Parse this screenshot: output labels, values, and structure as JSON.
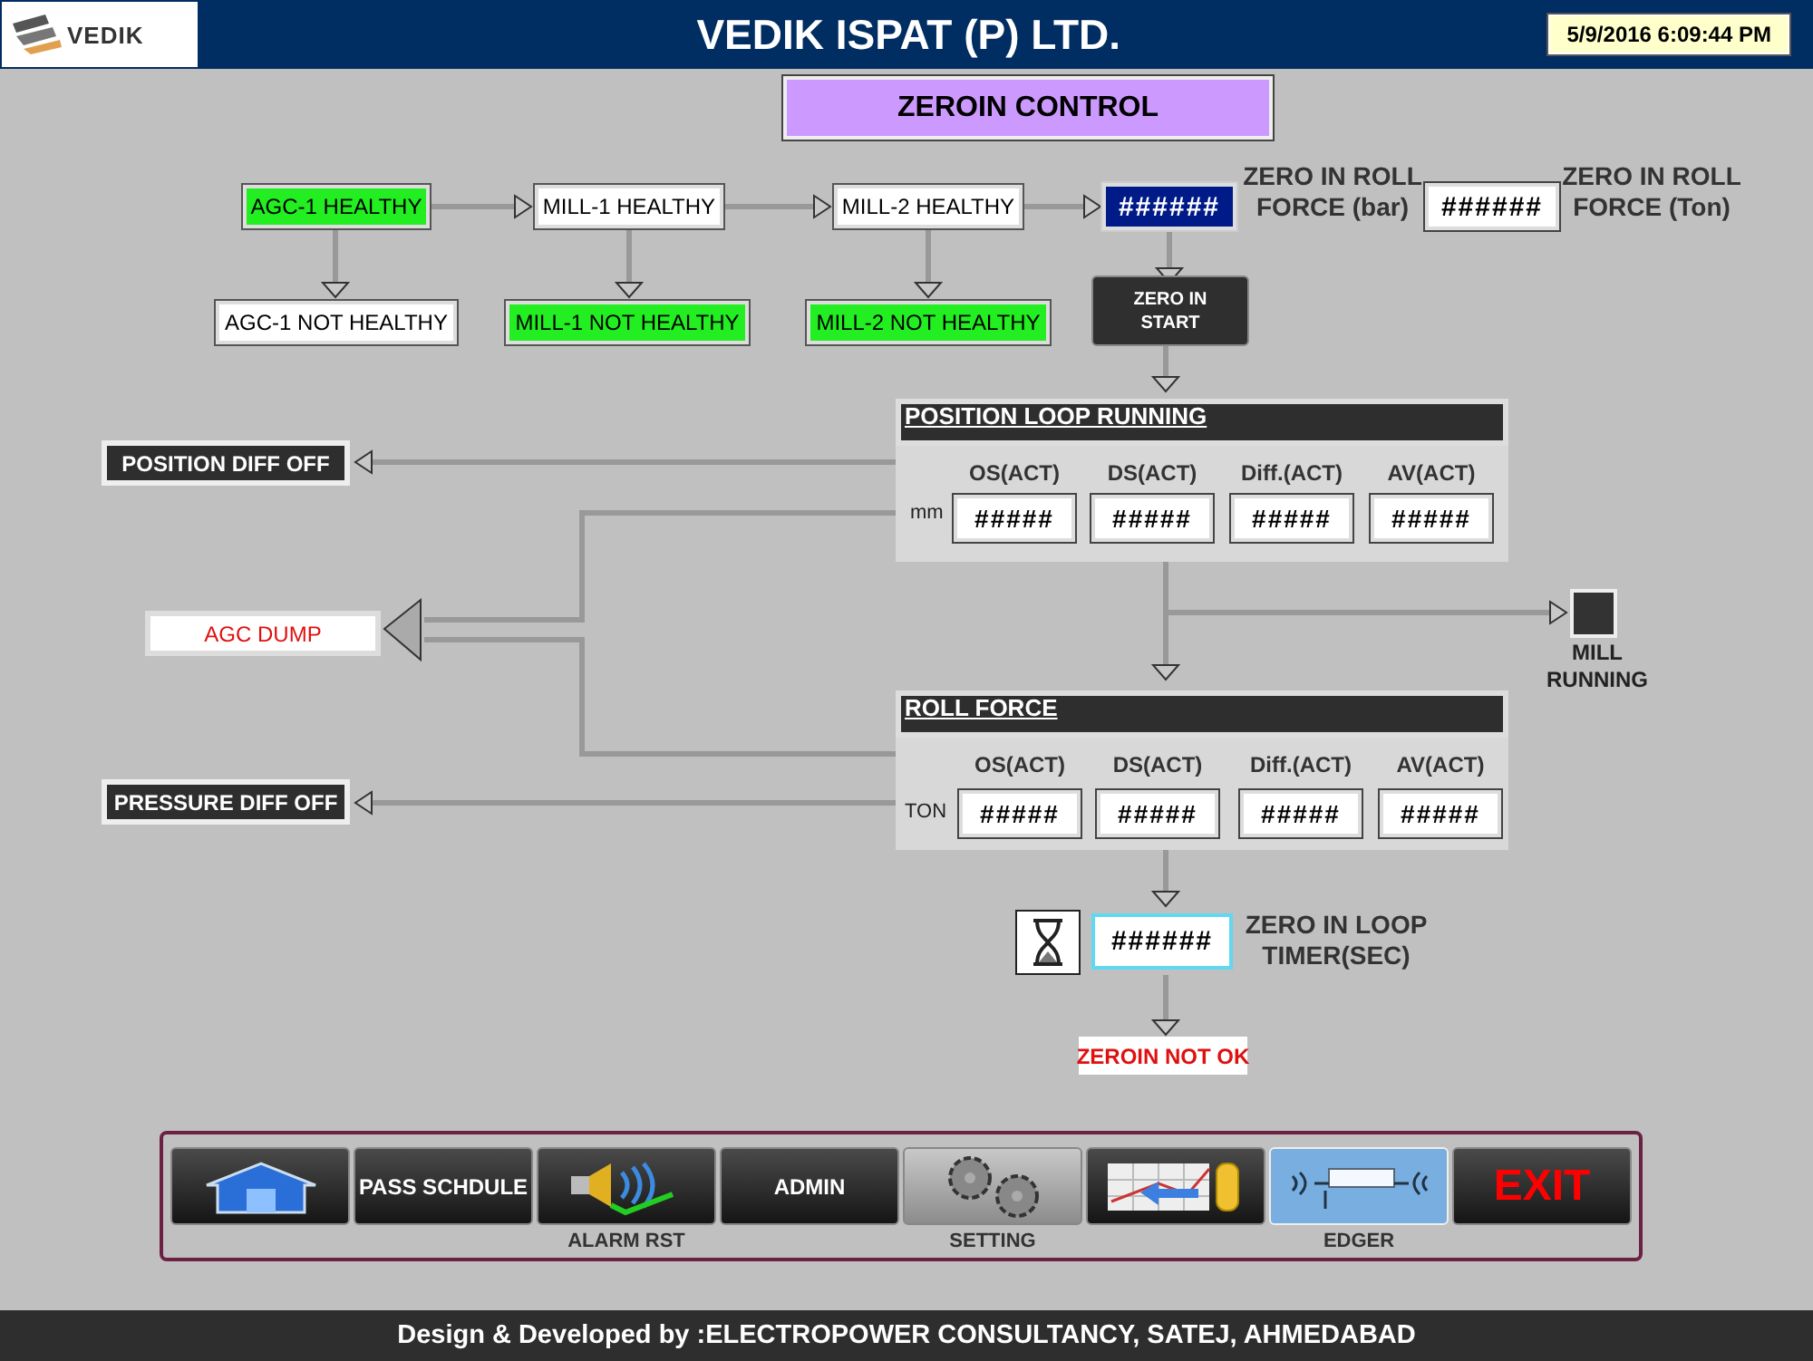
{
  "header": {
    "logo_text": "VEDIK",
    "title": "VEDIK ISPAT (P) LTD.",
    "datetime": "5/9/2016 6:09:44 PM"
  },
  "page_title": "ZEROIN CONTROL",
  "health": [
    {
      "label": "AGC-1 HEALTHY",
      "on": true
    },
    {
      "label": "MILL-1 HEALTHY",
      "on": false
    },
    {
      "label": "MILL-2 HEALTHY",
      "on": false
    }
  ],
  "faults": [
    {
      "label": "AGC-1 NOT HEALTHY",
      "on": false
    },
    {
      "label": "MILL-1 NOT HEALTHY",
      "on": true
    },
    {
      "label": "MILL-2 NOT HEALTHY",
      "on": true
    }
  ],
  "roll_force_bar": {
    "value": "######",
    "label": "ZERO IN ROLL FORCE (bar)"
  },
  "roll_force_ton": {
    "value": "######",
    "label": "ZERO IN ROLL FORCE (Ton)"
  },
  "start_button": "ZERO IN START",
  "panels": [
    {
      "title": "POSITION LOOP RUNNING",
      "unit": "mm",
      "columns": [
        "OS(ACT)",
        "DS(ACT)",
        "Diff.(ACT)",
        "AV(ACT)"
      ],
      "values": [
        "#####",
        "#####",
        "#####",
        "#####"
      ]
    },
    {
      "title": "ROLL FORCE",
      "unit": "TON",
      "columns": [
        "OS(ACT)",
        "DS(ACT)",
        "Diff.(ACT)",
        "AV(ACT)"
      ],
      "values": [
        "#####",
        "#####",
        "#####",
        "#####"
      ]
    }
  ],
  "side_indicators": [
    {
      "kind": "dark",
      "label": "POSITION DIFF OFF"
    },
    {
      "kind": "alarm",
      "label": "AGC DUMP"
    },
    {
      "kind": "dark",
      "label": "PRESSURE DIFF OFF"
    }
  ],
  "mill_running": {
    "label": "MILL RUNNING",
    "on": false
  },
  "timer": {
    "value": "######",
    "label": "ZERO IN LOOP TIMER(SEC)"
  },
  "result": "ZEROIN NOT OK",
  "nav": [
    {
      "kind": "home",
      "selected": false
    },
    {
      "kind": "text",
      "label": "PASS SCHDULE",
      "selected": false
    },
    {
      "kind": "alarm",
      "caption": "ALARM RST",
      "selected": false
    },
    {
      "kind": "text",
      "label": "ADMIN",
      "selected": false
    },
    {
      "kind": "gears",
      "caption": "SETTING",
      "selected": false
    },
    {
      "kind": "trend",
      "selected": false
    },
    {
      "kind": "edger",
      "caption": "EDGER",
      "selected": true
    },
    {
      "kind": "exit",
      "label": "EXIT",
      "selected": false
    }
  ],
  "footer": "Design & Developed by :ELECTROPOWER CONSULTANCY, SATEJ, AHMEDABAD"
}
